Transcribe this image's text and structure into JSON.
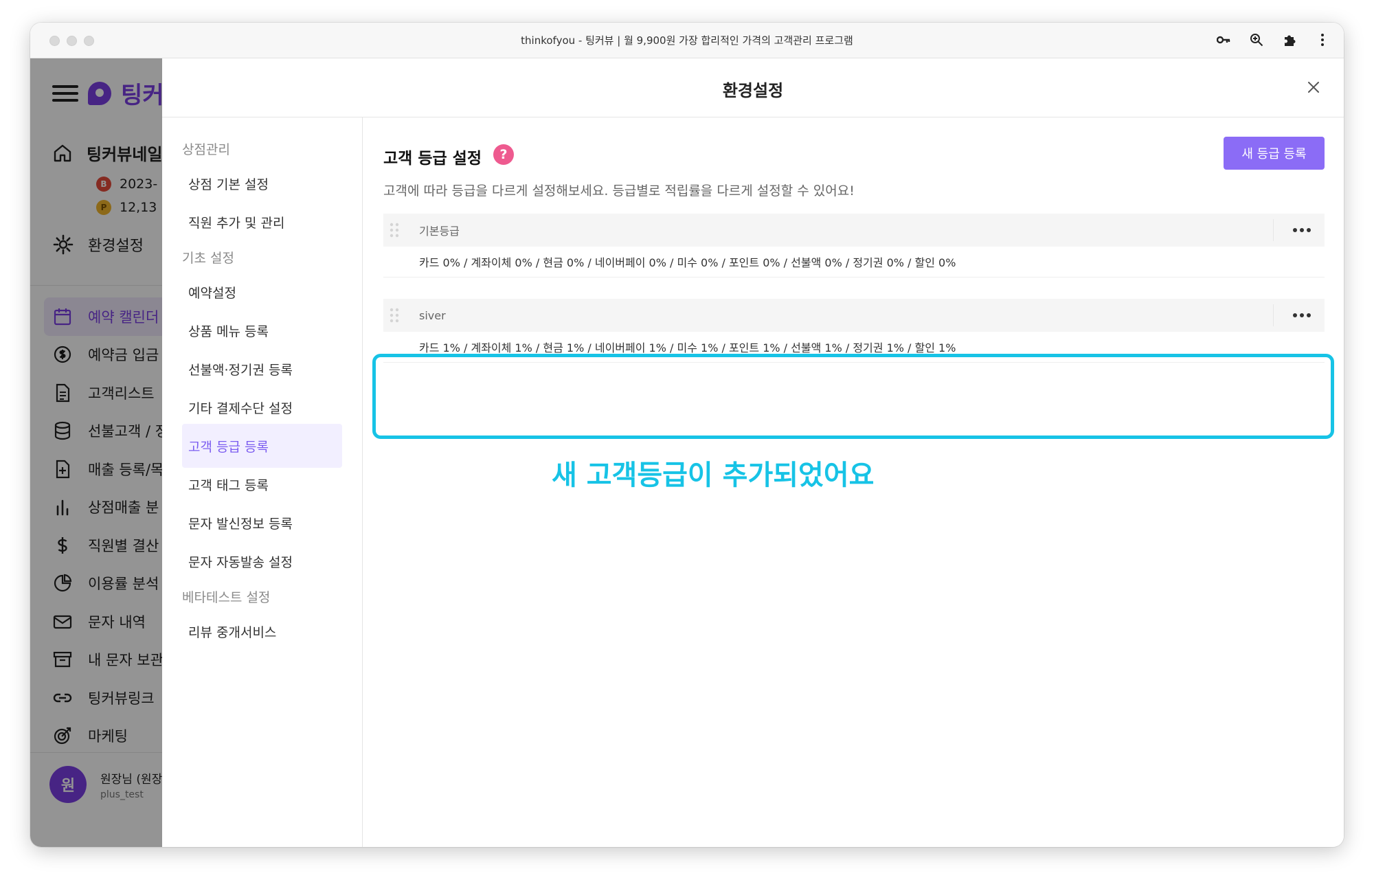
{
  "window": {
    "title": "thinkofyou - 팅커뷰 | 월 9,900원 가장 합리적인 가격의 고객관리 프로그램"
  },
  "app": {
    "logo_text": "팅커",
    "shop_name": "팅커뷰네일",
    "date_value": "2023-",
    "point_value": "12,13",
    "settings_label": "환경설정",
    "nav": [
      {
        "label": "예약 캘린더",
        "icon": "calendar-icon",
        "active": true
      },
      {
        "label": "예약금 입금",
        "icon": "dollar-circle-icon",
        "active": false
      },
      {
        "label": "고객리스트",
        "icon": "document-icon",
        "active": false
      },
      {
        "label": "선불고객 / 정",
        "icon": "database-icon",
        "active": false
      },
      {
        "label": "매출 등록/목",
        "icon": "file-plus-icon",
        "active": false
      },
      {
        "label": "상점매출 분",
        "icon": "bar-chart-icon",
        "active": false
      },
      {
        "label": "직원별 결산",
        "icon": "dollar-sign-icon",
        "active": false
      },
      {
        "label": "이용률 분석",
        "icon": "pie-chart-icon",
        "active": false
      },
      {
        "label": "문자 내역",
        "icon": "mail-icon",
        "active": false
      },
      {
        "label": "내 문자 보관",
        "icon": "archive-icon",
        "active": false
      },
      {
        "label": "팅커뷰링크",
        "icon": "link-icon",
        "active": false
      },
      {
        "label": "마케팅",
        "icon": "target-icon",
        "active": false
      }
    ],
    "user": {
      "avatar_text": "원",
      "name": "원장님 (원장",
      "id": "plus_test"
    }
  },
  "modal": {
    "title": "환경설정",
    "nav": {
      "section1": "상점관리",
      "store_basic": "상점 기본 설정",
      "staff": "직원 추가 및 관리",
      "section2": "기초 설정",
      "reservation": "예약설정",
      "product_menu": "상품 메뉴 등록",
      "prepaid": "선불액·정기권 등록",
      "payment": "기타 결제수단 설정",
      "grade": "고객 등급 등록",
      "tag": "고객 태그 등록",
      "sms_sender": "문자 발신정보 등록",
      "sms_auto": "문자 자동발송 설정",
      "section3": "베타테스트 설정",
      "review": "리뷰 중개서비스"
    },
    "content": {
      "title": "고객 등급 설정",
      "help_symbol": "?",
      "add_button": "새 등급 등록",
      "description": "고객에 따라 등급을 다르게 설정해보세요. 등급별로 적립률을 다르게 설정할 수 있어요!",
      "grades": [
        {
          "name": "기본등급",
          "rates": "카드 0% / 계좌이체 0% / 현금 0% / 네이버페이 0% / 미수 0% / 포인트 0% / 선불액 0% / 정기권 0% / 할인 0%"
        },
        {
          "name": "siver",
          "rates": "카드 1% / 계좌이체 1% / 현금 1% / 네이버페이 1% / 미수 1% / 포인트 1% / 선불액 1% / 정기권 1% / 할인 1%"
        }
      ],
      "callout": "새 고객등급이 추가되었어요"
    }
  },
  "colors": {
    "brand_purple": "#7b3fe4",
    "button_purple": "#8b6cf6",
    "highlight_cyan": "#17c3e6",
    "help_pink": "#ee5a8f"
  }
}
